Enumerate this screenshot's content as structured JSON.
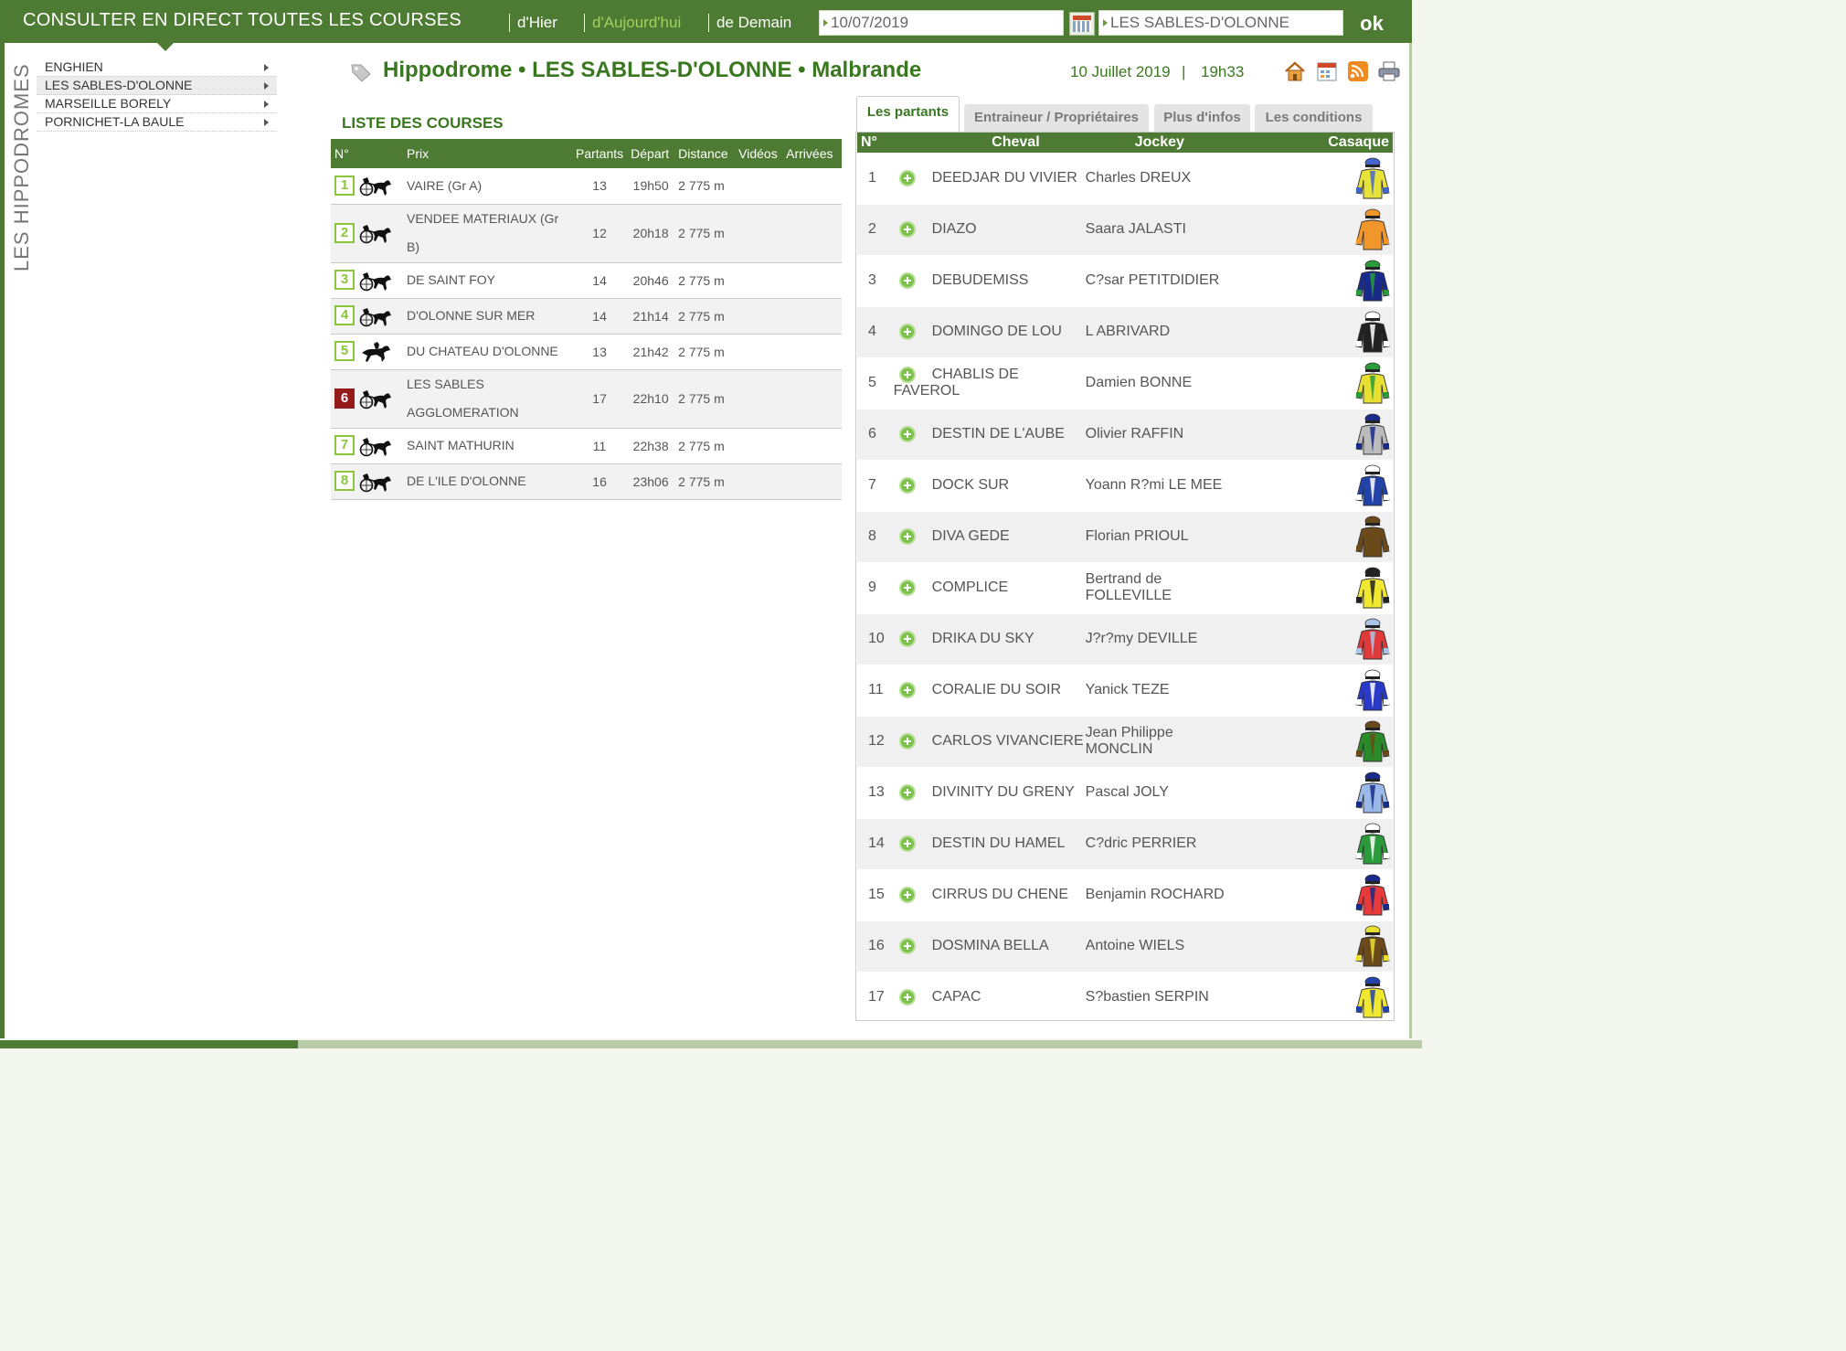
{
  "topbar": {
    "title": "CONSULTER EN DIRECT TOUTES LES COURSES",
    "links": [
      "d'Hier",
      "d'Aujourd'hui",
      "de Demain"
    ],
    "date_value": "10/07/2019",
    "place_value": "LES SABLES-D'OLONNE",
    "ok_label": "ok"
  },
  "sidebar": {
    "title": "LES HIPPODROMES",
    "items": [
      "ENGHIEN",
      "LES SABLES-D'OLONNE",
      "MARSEILLE BORELY",
      "PORNICHET-LA BAULE"
    ],
    "selected_index": 1
  },
  "header": {
    "title": "Hippodrome • LES SABLES-D'OLONNE • Malbrande",
    "date": "10 Juillet 2019",
    "separator": "|",
    "time": "19h33"
  },
  "races": {
    "title": "LISTE DES COURSES",
    "columns": [
      "N°",
      "Prix",
      "Partants",
      "Départ",
      "Distance",
      "Vidéos",
      "Arrivées"
    ],
    "current_index": 5,
    "rows": [
      {
        "num": "1",
        "type": "trot-attele",
        "prix": "VAIRE (Gr A)",
        "partants": "13",
        "depart": "19h50",
        "distance": "2 775 m"
      },
      {
        "num": "2",
        "type": "trot-attele",
        "prix": "VENDEE MATERIAUX (Gr B)",
        "partants": "12",
        "depart": "20h18",
        "distance": "2 775 m"
      },
      {
        "num": "3",
        "type": "trot-attele",
        "prix": "DE SAINT FOY",
        "partants": "14",
        "depart": "20h46",
        "distance": "2 775 m"
      },
      {
        "num": "4",
        "type": "trot-attele",
        "prix": "D'OLONNE SUR MER",
        "partants": "14",
        "depart": "21h14",
        "distance": "2 775 m"
      },
      {
        "num": "5",
        "type": "trot-monte",
        "prix": "DU CHATEAU D'OLONNE",
        "partants": "13",
        "depart": "21h42",
        "distance": "2 775 m"
      },
      {
        "num": "6",
        "type": "trot-attele",
        "prix": "LES SABLES AGGLOMERATION",
        "partants": "17",
        "depart": "22h10",
        "distance": "2 775 m"
      },
      {
        "num": "7",
        "type": "trot-attele",
        "prix": "SAINT MATHURIN",
        "partants": "11",
        "depart": "22h38",
        "distance": "2 775 m"
      },
      {
        "num": "8",
        "type": "trot-attele",
        "prix": "DE L'ILE D'OLONNE",
        "partants": "16",
        "depart": "23h06",
        "distance": "2 775 m"
      }
    ]
  },
  "tabs": [
    "Les partants",
    "Entraineur / Propriétaires",
    "Plus d'infos",
    "Les conditions"
  ],
  "active_tab": 0,
  "runners": {
    "columns": [
      "N°",
      "Cheval",
      "Jockey",
      "Casaque"
    ],
    "rows": [
      {
        "num": "1",
        "cheval": "DEEDJAR DU VIVIER",
        "jockey": "Charles DREUX",
        "colors": [
          "#e6e23a",
          "#4466cc"
        ]
      },
      {
        "num": "2",
        "cheval": "DIAZO",
        "jockey": "Saara JALASTI",
        "colors": [
          "#f0962a",
          "#f0962a"
        ]
      },
      {
        "num": "3",
        "cheval": "DEBUDEMISS",
        "jockey": "C?sar PETITDIDIER",
        "colors": [
          "#1a2a8a",
          "#2a9a3a"
        ]
      },
      {
        "num": "4",
        "cheval": "DOMINGO DE LOU",
        "jockey": "L ABRIVARD",
        "colors": [
          "#222222",
          "#ffffff"
        ]
      },
      {
        "num": "5",
        "cheval": "CHABLIS DE FAVEROL",
        "jockey": "Damien BONNE",
        "colors": [
          "#e8e030",
          "#2a9a3a"
        ]
      },
      {
        "num": "6",
        "cheval": "DESTIN DE L'AUBE",
        "jockey": "Olivier RAFFIN",
        "colors": [
          "#bbbbbb",
          "#1a2a8a"
        ]
      },
      {
        "num": "7",
        "cheval": "DOCK SUR",
        "jockey": "Yoann R?mi LE MEE",
        "colors": [
          "#2244aa",
          "#ffffff"
        ]
      },
      {
        "num": "8",
        "cheval": "DIVA GEDE",
        "jockey": "Florian PRIOUL",
        "colors": [
          "#6a4a1a",
          "#6a4a1a"
        ]
      },
      {
        "num": "9",
        "cheval": "COMPLICE",
        "jockey": "Bertrand de FOLLEVILLE",
        "colors": [
          "#f0e830",
          "#222222"
        ]
      },
      {
        "num": "10",
        "cheval": "DRIKA DU SKY",
        "jockey": "J?r?my DEVILLE",
        "colors": [
          "#e03a3a",
          "#aac4e8"
        ]
      },
      {
        "num": "11",
        "cheval": "CORALIE DU SOIR",
        "jockey": "Yanick TEZE",
        "colors": [
          "#2a3ac8",
          "#ffffff"
        ]
      },
      {
        "num": "12",
        "cheval": "CARLOS VIVANCIERE",
        "jockey": "Jean Philippe MONCLIN",
        "colors": [
          "#2a8a2a",
          "#6a4a1a"
        ]
      },
      {
        "num": "13",
        "cheval": "DIVINITY DU GRENY",
        "jockey": "Pascal JOLY",
        "colors": [
          "#9ab8e8",
          "#1a2a8a"
        ]
      },
      {
        "num": "14",
        "cheval": "DESTIN DU HAMEL",
        "jockey": "C?dric PERRIER",
        "colors": [
          "#2a9a3a",
          "#ffffff"
        ]
      },
      {
        "num": "15",
        "cheval": "CIRRUS DU CHENE",
        "jockey": "Benjamin ROCHARD",
        "colors": [
          "#e83a3a",
          "#1a2a8a"
        ]
      },
      {
        "num": "16",
        "cheval": "DOSMINA BELLA",
        "jockey": "Antoine WIELS",
        "colors": [
          "#6a4a1a",
          "#e8e030"
        ]
      },
      {
        "num": "17",
        "cheval": "CAPAC",
        "jockey": "S?bastien SERPIN",
        "colors": [
          "#f0e830",
          "#2244aa"
        ]
      }
    ]
  }
}
